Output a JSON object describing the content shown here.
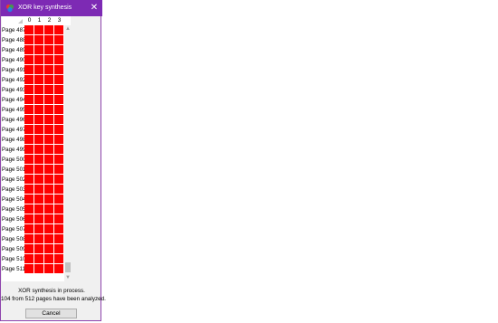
{
  "window": {
    "title": "XOR key synthesis",
    "close_glyph": "✕",
    "border_color": "#8e44ad",
    "titlebar_color": "#7d2ab4"
  },
  "grid": {
    "columns": [
      "0",
      "1",
      "2",
      "3"
    ],
    "rows": [
      "Page 487",
      "Page 488",
      "Page 489",
      "Page 490",
      "Page 491",
      "Page 492",
      "Page 493",
      "Page 494",
      "Page 495",
      "Page 496",
      "Page 497",
      "Page 498",
      "Page 499",
      "Page 500",
      "Page 501",
      "Page 502",
      "Page 503",
      "Page 504",
      "Page 505",
      "Page 506",
      "Page 507",
      "Page 508",
      "Page 509",
      "Page 510",
      "Page 511"
    ],
    "cell_color": "#ff0000"
  },
  "scrollbar": {
    "up_glyph": "▲",
    "down_glyph": "▼"
  },
  "status": {
    "line1": "XOR synthesis in process.",
    "line2": "104 from 512 pages have been analyzed."
  },
  "buttons": {
    "cancel": "Cancel"
  }
}
